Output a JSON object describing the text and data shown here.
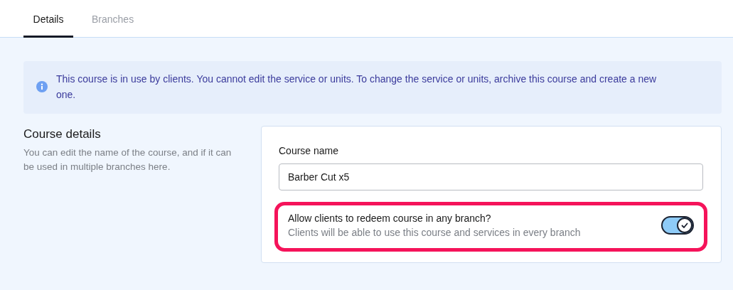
{
  "tabs": [
    {
      "label": "Details",
      "selected": true
    },
    {
      "label": "Branches",
      "selected": false
    }
  ],
  "alert": {
    "text": "This course is in use by clients. You cannot edit the service or units. To change the service or units, archive this course and create a new one."
  },
  "section": {
    "title": "Course details",
    "description": "You can edit the name of the course, and if it can be used in multiple branches here."
  },
  "course_name": {
    "label": "Course name",
    "value": "Barber Cut x5"
  },
  "redeem_setting": {
    "title": "Allow clients to redeem course in any branch?",
    "description": "Clients will be able to use this course and services in every branch",
    "on": true,
    "highlighted": true
  }
}
